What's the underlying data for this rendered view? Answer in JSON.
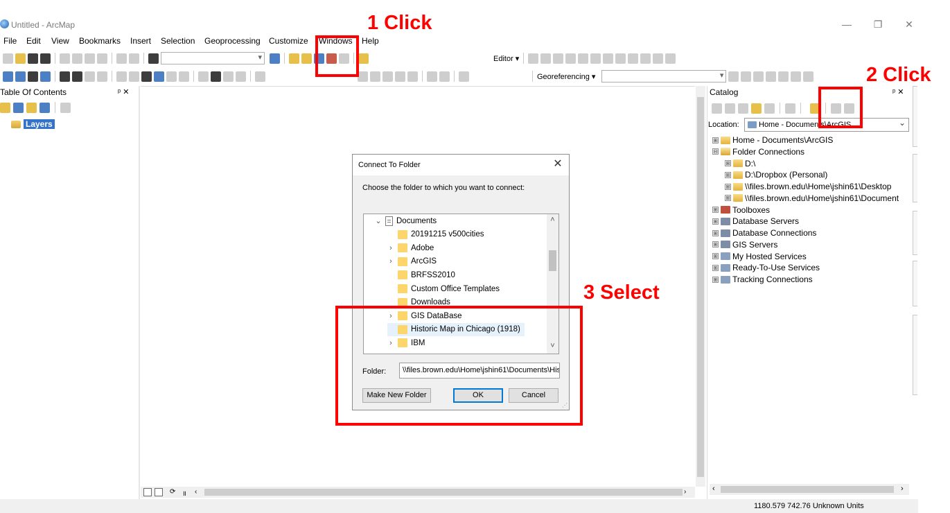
{
  "window": {
    "title": "Untitled - ArcMap",
    "minimize": "—",
    "restore": "❐",
    "close": "✕"
  },
  "menu": [
    "File",
    "Edit",
    "View",
    "Bookmarks",
    "Insert",
    "Selection",
    "Geoprocessing",
    "Customize",
    "Windows",
    "Help"
  ],
  "toolbars": {
    "editor_label": "Editor ▾",
    "georeferencing_label": "Georeferencing ▾"
  },
  "toc": {
    "title": "Table Of Contents",
    "pin": "ᵖ ✕",
    "root_layer": "Layers"
  },
  "catalog": {
    "title": "Catalog",
    "pin": "ᵖ ✕",
    "location_label": "Location:",
    "location_value": "Home - Documents\\ArcGIS",
    "tree": [
      {
        "exp": "⊞",
        "icon": "folder",
        "label": "Home - Documents\\ArcGIS",
        "indent": 0
      },
      {
        "exp": "⊟",
        "icon": "folder-open",
        "label": "Folder Connections",
        "indent": 0
      },
      {
        "exp": "⊞",
        "icon": "folder",
        "label": "D:\\",
        "indent": 1
      },
      {
        "exp": "⊞",
        "icon": "folder",
        "label": "D:\\Dropbox (Personal)",
        "indent": 1
      },
      {
        "exp": "⊞",
        "icon": "folder",
        "label": "\\\\files.brown.edu\\Home\\jshin61\\Desktop",
        "indent": 1
      },
      {
        "exp": "⊞",
        "icon": "folder",
        "label": "\\\\files.brown.edu\\Home\\jshin61\\Document",
        "indent": 1
      },
      {
        "exp": "⊞",
        "icon": "tool",
        "label": "Toolboxes",
        "indent": 0
      },
      {
        "exp": "⊞",
        "icon": "db",
        "label": "Database Servers",
        "indent": 0
      },
      {
        "exp": "⊞",
        "icon": "db",
        "label": "Database Connections",
        "indent": 0
      },
      {
        "exp": "⊞",
        "icon": "db",
        "label": "GIS Servers",
        "indent": 0
      },
      {
        "exp": "⊞",
        "icon": "svc",
        "label": "My Hosted Services",
        "indent": 0
      },
      {
        "exp": "⊞",
        "icon": "svc",
        "label": "Ready-To-Use Services",
        "indent": 0
      },
      {
        "exp": "⊞",
        "icon": "svc",
        "label": "Tracking Connections",
        "indent": 0
      }
    ]
  },
  "dialog": {
    "title": "Connect To Folder",
    "close": "✕",
    "prompt": "Choose the folder to which you want to connect:",
    "tree": [
      {
        "chev": "⌄",
        "label": "Documents",
        "type": "doc",
        "indent": 0,
        "selected": false
      },
      {
        "chev": "",
        "label": "20191215 v500cities",
        "type": "folder",
        "indent": 1,
        "selected": false
      },
      {
        "chev": "›",
        "label": "Adobe",
        "type": "folder",
        "indent": 1,
        "selected": false
      },
      {
        "chev": "›",
        "label": "ArcGIS",
        "type": "folder",
        "indent": 1,
        "selected": false
      },
      {
        "chev": "",
        "label": "BRFSS2010",
        "type": "folder",
        "indent": 1,
        "selected": false
      },
      {
        "chev": "",
        "label": "Custom Office Templates",
        "type": "folder",
        "indent": 1,
        "selected": false
      },
      {
        "chev": "",
        "label": "Downloads",
        "type": "folder",
        "indent": 1,
        "selected": false
      },
      {
        "chev": "›",
        "label": "GIS DataBase",
        "type": "folder",
        "indent": 1,
        "selected": false
      },
      {
        "chev": "",
        "label": "Historic Map in Chicago (1918)",
        "type": "folder",
        "indent": 1,
        "selected": true
      },
      {
        "chev": "›",
        "label": "IBM",
        "type": "folder",
        "indent": 1,
        "selected": false
      }
    ],
    "scroll_up": "˄",
    "scroll_down": "˅",
    "folder_label": "Folder:",
    "folder_value": "\\\\files.brown.edu\\Home\\jshin61\\Documents\\His",
    "make_new_folder": "Make New Folder",
    "ok": "OK",
    "cancel": "Cancel"
  },
  "status": {
    "coords": "1180.579  742.76 Unknown Units"
  },
  "annotations": {
    "step1": "1 Click",
    "step2": "2 Click",
    "step3": "3 Select",
    "color": "#ff0000"
  }
}
